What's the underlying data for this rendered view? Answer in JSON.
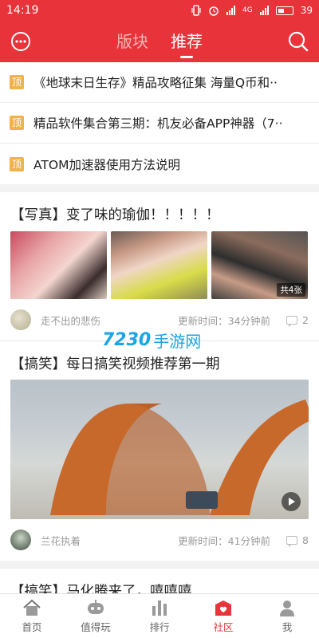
{
  "status_bar": {
    "time": "14:19",
    "network": "4G",
    "battery": "39"
  },
  "header": {
    "tabs": [
      {
        "label": "版块",
        "active": false
      },
      {
        "label": "推荐",
        "active": true
      }
    ],
    "left_icon": "message-icon",
    "right_icon": "search-icon"
  },
  "pinned": {
    "badge": "顶",
    "items": [
      "《地球末日生存》精品攻略征集 海量Q币和··",
      "精品软件集合第三期：机友必备APP神器（7··",
      "ATOM加速器使用方法说明"
    ]
  },
  "posts": [
    {
      "title": "【写真】变了味的瑜伽！！！！！",
      "image_count": "共4张",
      "author": "走不出的悲伤",
      "updated": "更新时间：34分钟前",
      "comments": "2"
    },
    {
      "title": "【搞笑】每日搞笑视频推荐第一期",
      "author": "兰花执着",
      "updated": "更新时间：41分钟前",
      "comments": "8"
    },
    {
      "title": "【搞笑】马化腾来了，嘻嘻嘻"
    }
  ],
  "watermark": {
    "number": "7230",
    "text": "手游网"
  },
  "bottom_nav": [
    {
      "label": "首页",
      "icon": "home-icon",
      "active": false
    },
    {
      "label": "值得玩",
      "icon": "gamepad-icon",
      "active": false
    },
    {
      "label": "排行",
      "icon": "ranking-icon",
      "active": false
    },
    {
      "label": "社区",
      "icon": "community-icon",
      "active": true
    },
    {
      "label": "我",
      "icon": "user-icon",
      "active": false
    }
  ],
  "colors": {
    "accent": "#e8333a",
    "pin_badge": "#f2b24a",
    "watermark": "#1aa6e6"
  }
}
